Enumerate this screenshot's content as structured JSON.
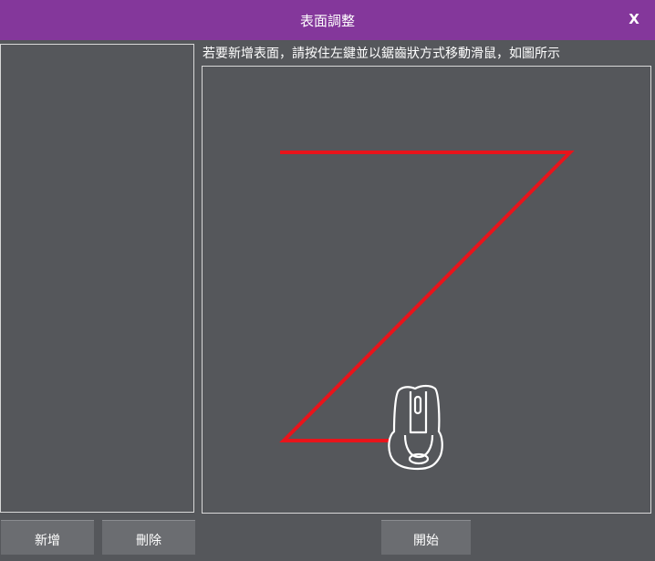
{
  "window": {
    "title": "表面調整",
    "close_label": "X"
  },
  "instruction": "若要新增表面，請按住左鍵並以鋸齒狀方式移動滑鼠，如圖所示",
  "buttons": {
    "add": "新增",
    "delete": "刪除",
    "start": "開始"
  },
  "colors": {
    "titlebar": "#84379b",
    "background": "#55575b",
    "guide_path": "#e8141b",
    "button": "#6b6d71"
  },
  "icons": {
    "close": "close-icon",
    "mouse": "mouse-icon"
  }
}
